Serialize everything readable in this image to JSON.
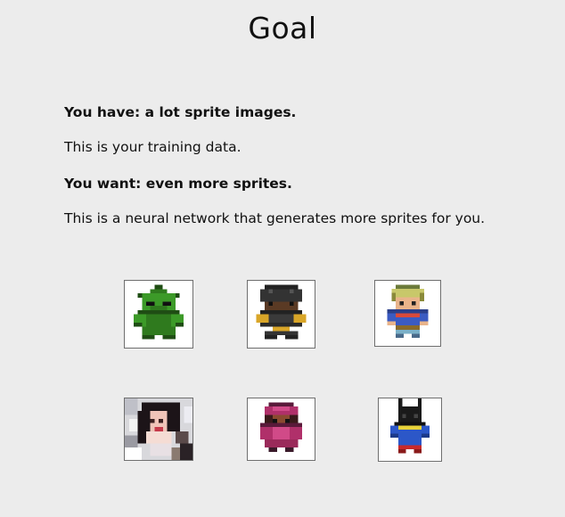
{
  "slide": {
    "title": "Goal",
    "lines": [
      {
        "text": "You have: a lot sprite images.",
        "bold": true
      },
      {
        "text": "This is your training data.",
        "bold": false
      },
      {
        "text": "You want: even more sprites.",
        "bold": true
      },
      {
        "text": "This is a neural network that generates more sprites for you.",
        "bold": false
      }
    ]
  },
  "sprites": [
    {
      "name": "green goblin sprite",
      "icon": "sprite-green-goblin"
    },
    {
      "name": "dark knight sprite",
      "icon": "sprite-dark-knight"
    },
    {
      "name": "blonde hero sprite",
      "icon": "sprite-blonde-hero"
    },
    {
      "name": "noisy portrait sprite",
      "icon": "sprite-noisy-portrait"
    },
    {
      "name": "magenta mage sprite",
      "icon": "sprite-magenta-mage"
    },
    {
      "name": "dark blue hero sprite",
      "icon": "sprite-dark-hero"
    }
  ],
  "colors": {
    "background": "#ececec",
    "text": "#111111",
    "sprite_border": "#6f6f6f"
  }
}
